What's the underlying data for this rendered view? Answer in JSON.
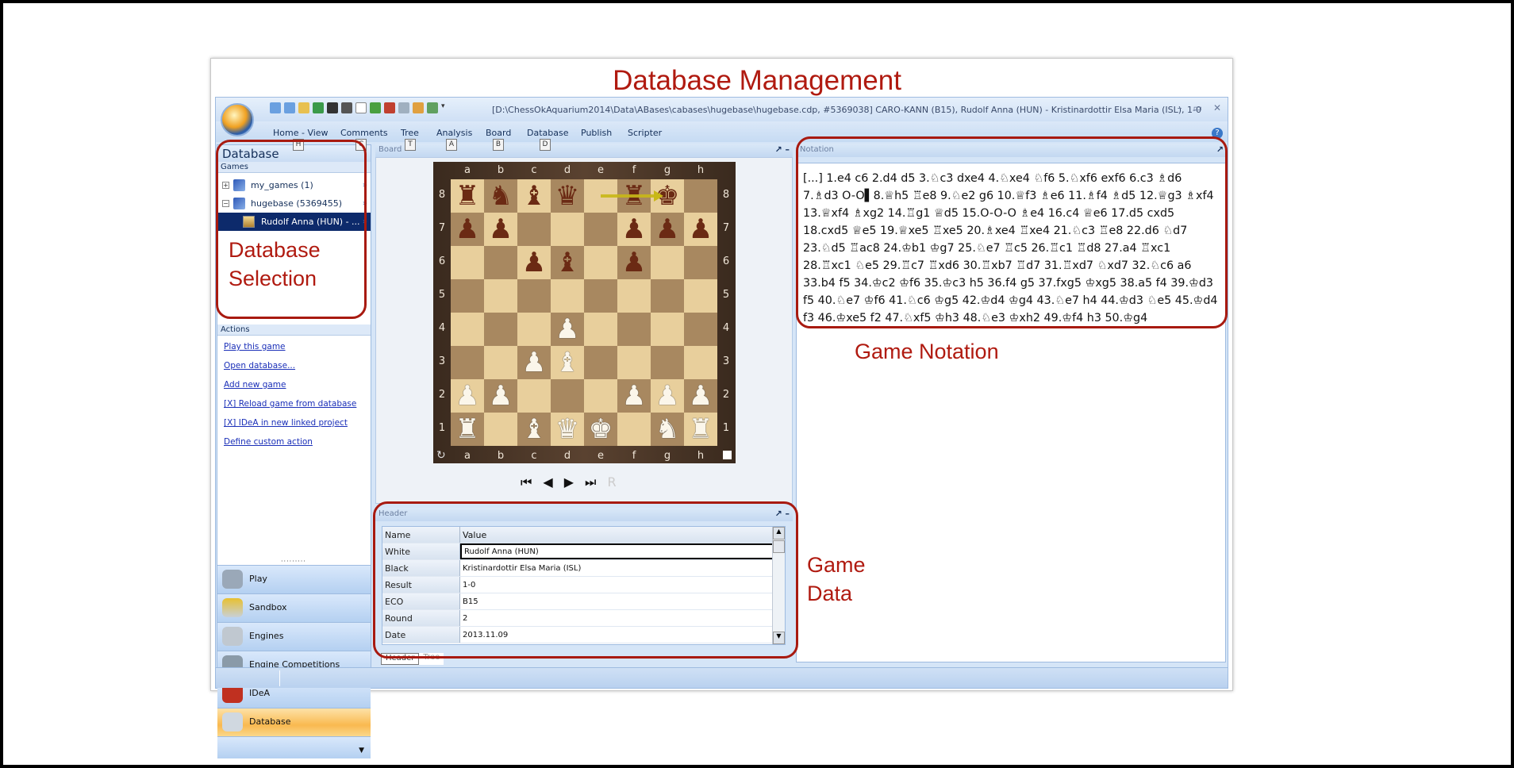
{
  "annotation_title": "Database Management",
  "annotations": {
    "database_selection": "Database\nSelection",
    "game_notation": "Game Notation",
    "game_data": "Game\nData"
  },
  "window": {
    "title": "[D:\\ChessOkAquarium2014\\Data\\ABases\\cabases\\hugebase\\hugebase.cdp, #5369038] CARO-KANN (B15), Rudolf Anna (HUN) - Kristinardottir Elsa Maria (ISL), 1-0",
    "controls": [
      "–",
      "▭",
      "✕"
    ]
  },
  "menu": [
    "Home - View",
    "Comments",
    "Tree",
    "Analysis",
    "Board",
    "Database",
    "Publish",
    "Scripter"
  ],
  "keytips": [
    "H",
    "C",
    "T",
    "A",
    "B",
    "D"
  ],
  "left": {
    "title": "Database",
    "games_label": "Games",
    "tree": [
      {
        "toggle": "+",
        "label": "my_games (1)"
      },
      {
        "toggle": "−",
        "label": "hugebase (5369455)"
      },
      {
        "label": "Rudolf Anna (HUN) - ...",
        "selected": true
      }
    ],
    "actions_label": "Actions",
    "actions": [
      "Play this game",
      "Open database...",
      "Add new game",
      "[X] Reload game from database",
      "[X] IDeA in new linked project",
      "Define custom action"
    ],
    "nav": [
      "Play",
      "Sandbox",
      "Engines",
      "Engine Competitions",
      "IDeA",
      "Database"
    ],
    "active_nav": "Database"
  },
  "board": {
    "panel_title": "Board",
    "files": [
      "a",
      "b",
      "c",
      "d",
      "e",
      "f",
      "g",
      "h"
    ],
    "ranks": [
      "8",
      "7",
      "6",
      "5",
      "4",
      "3",
      "2",
      "1"
    ],
    "position": [
      "rnbq.rk.",
      "pp...ppp",
      "..pb.p..",
      "........",
      "...P....",
      "..PB....",
      "PP...PPP",
      "R.BQK.NR"
    ],
    "last_move_arrow": [
      "e8",
      "g8"
    ],
    "side_to_move": "white"
  },
  "header_panel": {
    "title": "Header",
    "columns": [
      "Name",
      "Value"
    ],
    "rows": [
      [
        "White",
        "Rudolf Anna (HUN)"
      ],
      [
        "Black",
        "Kristinardottir Elsa Maria (ISL)"
      ],
      [
        "Result",
        "1-0"
      ],
      [
        "ECO",
        "B15"
      ],
      [
        "Round",
        "2"
      ],
      [
        "Date",
        "2013.11.09"
      ]
    ],
    "tabs": [
      "Header",
      "Tree"
    ]
  },
  "notation": {
    "panel_title": "Notation",
    "text": "[...] 1.e4 c6 2.d4 d5 3.♘c3 dxe4 4.♘xe4 ♘f6 5.♘xf6 exf6 6.c3 ♗d6 7.♗d3 O-O▌8.♕h5 ♖e8 9.♘e2 g6 10.♕f3 ♗e6 11.♗f4 ♗d5 12.♕g3 ♗xf4 13.♕xf4 ♗xg2 14.♖g1 ♕d5 15.O-O-O ♗e4 16.c4 ♕e6 17.d5 cxd5 18.cxd5 ♕e5 19.♕xe5 ♖xe5 20.♗xe4 ♖xe4 21.♘c3 ♖e8 22.d6 ♘d7 23.♘d5 ♖ac8 24.♔b1 ♔g7 25.♘e7 ♖c5 26.♖c1 ♖d8 27.a4 ♖xc1 28.♖xc1 ♘e5 29.♖c7 ♖xd6 30.♖xb7 ♖d7 31.♖xd7 ♘xd7 32.♘c6 a6 33.b4 f5 34.♔c2 ♔f6 35.♔c3 h5 36.f4 g5 37.fxg5 ♔xg5 38.a5 f4 39.♔d3 f5 40.♘e7 ♔f6 41.♘c6 ♔g5 42.♔d4 ♔g4 43.♘e7 h4 44.♔d3 ♘e5 45.♔d4 f3 46.♔xe5 f2 47.♘xf5 ♔h3 48.♘e3 ♔xh2 49.♔f4 h3 50.♔g4"
  },
  "colors": {
    "annotation_red": "#b01a10",
    "selected_row": "#0d2a6b",
    "active_nav": "#f9b950",
    "ribbon": "#c6dbf3"
  }
}
